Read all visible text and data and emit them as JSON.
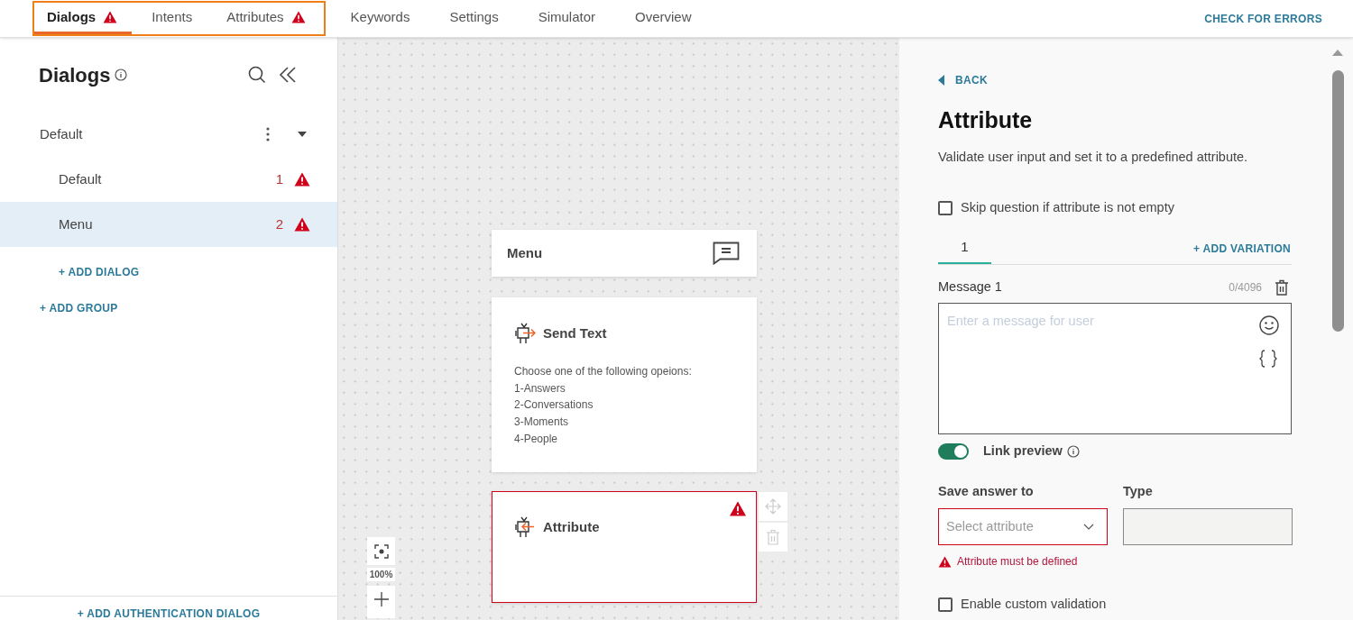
{
  "tabs": [
    {
      "label": "Dialogs",
      "selected": true,
      "error": true,
      "highlighted": true
    },
    {
      "label": "Intents",
      "selected": false,
      "error": false,
      "highlighted": true
    },
    {
      "label": "Attributes",
      "selected": false,
      "error": true,
      "highlighted": true
    },
    {
      "label": "Keywords",
      "selected": false,
      "error": false,
      "highlighted": false
    },
    {
      "label": "Settings",
      "selected": false,
      "error": false,
      "highlighted": false
    },
    {
      "label": "Simulator",
      "selected": false,
      "error": false,
      "highlighted": false
    },
    {
      "label": "Overview",
      "selected": false,
      "error": false,
      "highlighted": false
    }
  ],
  "check_errors": "CHECK FOR ERRORS",
  "sidebar": {
    "title": "Dialogs",
    "groups": [
      {
        "name": "Default",
        "expanded": true,
        "add_dialog": "+ ADD DIALOG",
        "children": [
          {
            "name": "Default",
            "count": "1",
            "selected": false
          },
          {
            "name": "Menu",
            "count": "2",
            "selected": true
          }
        ]
      }
    ],
    "add_group": "+ ADD GROUP",
    "add_auth": "+ ADD AUTHENTICATION DIALOG"
  },
  "canvas": {
    "zoom": "100%",
    "nodes": [
      {
        "kind": "header",
        "title": "Menu",
        "error": false
      },
      {
        "kind": "send_text",
        "title": "Send Text",
        "error": false,
        "lines": [
          "Choose one of the following opeions:",
          "1-Answers",
          "2-Conversations",
          "3-Moments",
          "4-People"
        ]
      },
      {
        "kind": "attribute",
        "title": "Attribute",
        "error": true
      }
    ]
  },
  "panel": {
    "back": "BACK",
    "title": "Attribute",
    "description": "Validate user input and set it to a predefined attribute.",
    "skip": {
      "label": "Skip question if attribute is not empty",
      "checked": false
    },
    "variations": [
      {
        "label": "1",
        "selected": true
      }
    ],
    "add_variation": "+ ADD VARIATION",
    "message": {
      "label": "Message 1",
      "counter": "0/4096",
      "placeholder": "Enter a message for user"
    },
    "link_preview": {
      "label": "Link preview",
      "on": true
    },
    "save_answer": {
      "label": "Save answer to",
      "placeholder": "Select attribute",
      "error": "Attribute must be defined"
    },
    "type": {
      "label": "Type"
    },
    "custom_validation": {
      "label": "Enable custom validation",
      "checked": false
    }
  }
}
